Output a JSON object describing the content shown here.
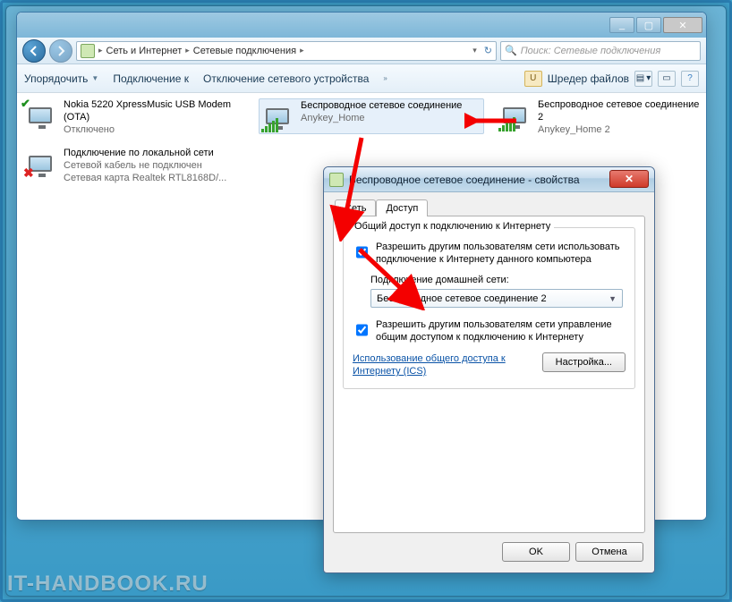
{
  "window": {
    "min_label": "_",
    "max_label": "▢",
    "close_label": "✕"
  },
  "breadcrumb": {
    "item1": "Сеть и Интернет",
    "item2": "Сетевые подключения"
  },
  "search": {
    "placeholder": "Поиск: Сетевые подключения"
  },
  "toolbar": {
    "organize": "Упорядочить",
    "connect": "Подключение к",
    "disable": "Отключение сетевого устройства",
    "shredder": "Шредер файлов"
  },
  "connections": [
    {
      "name": "Nokia 5220 XpressMusic USB Modem (OTA)",
      "status": "Отключено",
      "detail": "",
      "type": "modem",
      "state": "ok"
    },
    {
      "name": "Беспроводное сетевое соединение",
      "status": "",
      "detail": "Anykey_Home",
      "type": "wifi",
      "state": "active"
    },
    {
      "name": "Беспроводное сетевое соединение 2",
      "status": "",
      "detail": "Anykey_Home 2",
      "type": "wifi",
      "state": "active"
    },
    {
      "name": "Подключение по локальной сети",
      "status": "Сетевой кабель не подключен",
      "detail": "Сетевая карта Realtek RTL8168D/...",
      "type": "lan",
      "state": "error"
    }
  ],
  "dialog": {
    "title": "Беспроводное сетевое соединение - свойства",
    "tab_network": "Сеть",
    "tab_sharing": "Доступ",
    "group_title": "Общий доступ к подключению к Интернету",
    "chk_allow": "Разрешить другим пользователям сети использовать подключение к Интернету данного компьютера",
    "home_label": "Подключение домашней сети:",
    "home_value": "Беспроводное сетевое соединение 2",
    "chk_control": "Разрешить другим пользователям сети управление общим доступом к подключению к Интернету",
    "ics_link": "Использование общего доступа к Интернету (ICS)",
    "settings_btn": "Настройка...",
    "ok": "OK",
    "cancel": "Отмена"
  },
  "watermark": "IT-HANDBOOK.RU"
}
